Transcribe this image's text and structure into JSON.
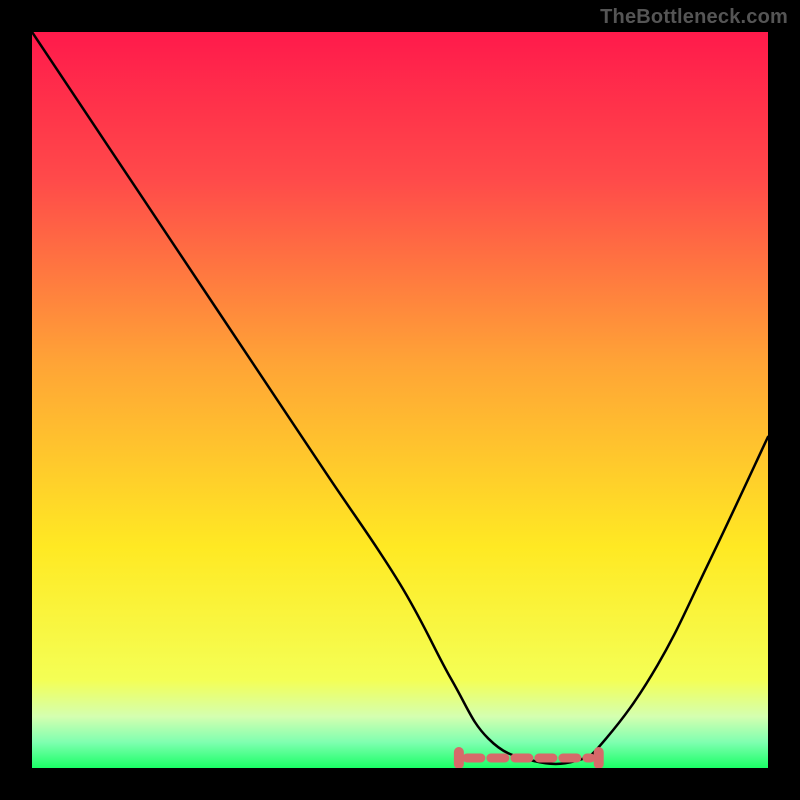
{
  "attribution": "TheBottleneck.com",
  "chart_data": {
    "type": "line",
    "title": "",
    "xlabel": "",
    "ylabel": "",
    "xlim": [
      0,
      100
    ],
    "ylim": [
      0,
      100
    ],
    "series": [
      {
        "name": "bottleneck-curve",
        "x": [
          0,
          10,
          20,
          30,
          40,
          50,
          57,
          62,
          68,
          74,
          78,
          85,
          92,
          100
        ],
        "y": [
          100,
          85,
          70,
          55,
          40,
          25,
          12,
          4,
          1,
          1,
          4,
          14,
          28,
          45
        ]
      }
    ],
    "optimal_region": {
      "x_start": 58,
      "x_end": 77
    },
    "gradient_stops": [
      {
        "pos": 0.0,
        "color": "#ff1a4b"
      },
      {
        "pos": 0.2,
        "color": "#ff4a4a"
      },
      {
        "pos": 0.45,
        "color": "#ffa436"
      },
      {
        "pos": 0.7,
        "color": "#ffe923"
      },
      {
        "pos": 0.88,
        "color": "#f4ff55"
      },
      {
        "pos": 0.93,
        "color": "#d4ffb0"
      },
      {
        "pos": 0.965,
        "color": "#7fffb0"
      },
      {
        "pos": 1.0,
        "color": "#1aff66"
      }
    ]
  }
}
